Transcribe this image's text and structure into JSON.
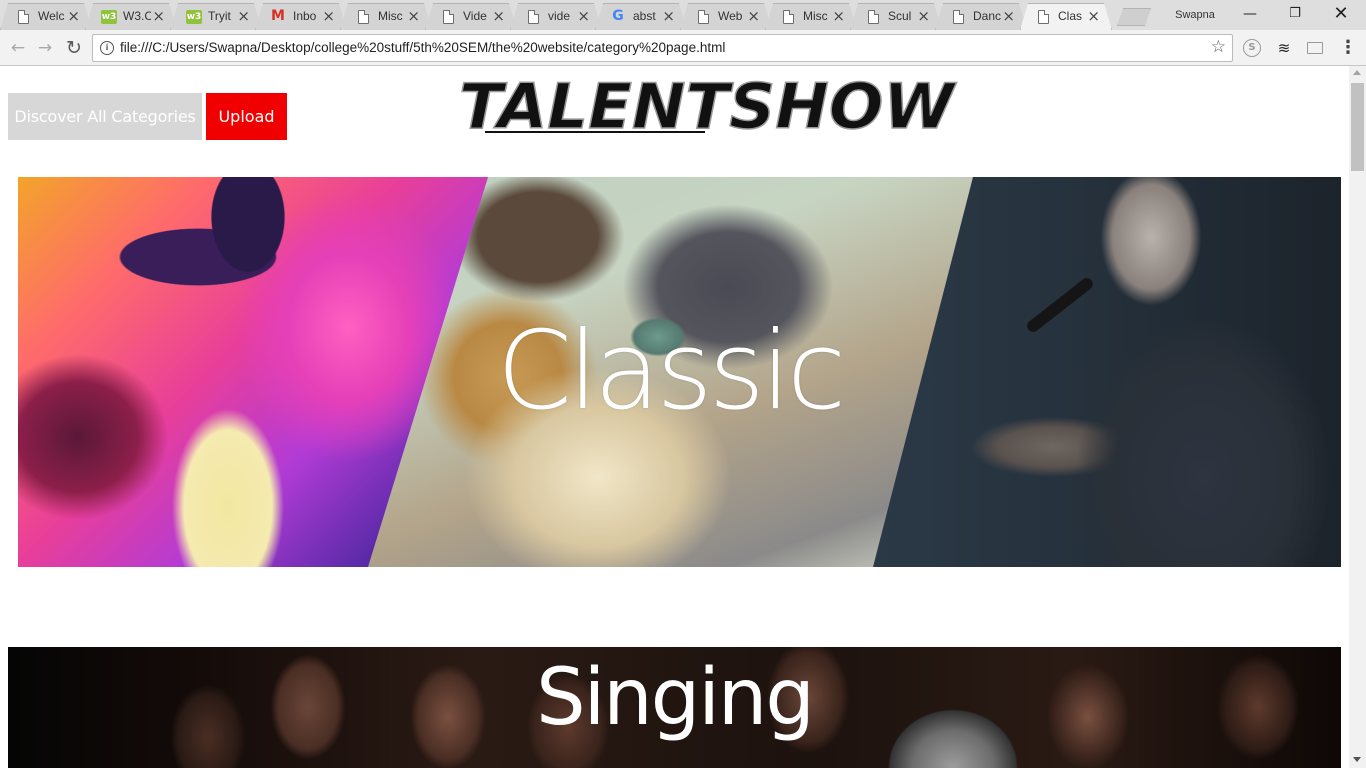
{
  "browser": {
    "tabs": [
      {
        "title": "Welc",
        "favicon": "page-icon",
        "active": false
      },
      {
        "title": "W3.C",
        "favicon": "w3-icon",
        "active": false
      },
      {
        "title": "Tryit",
        "favicon": "w3-icon",
        "active": false
      },
      {
        "title": "Inbo",
        "favicon": "gmail-icon",
        "active": false
      },
      {
        "title": "Misc",
        "favicon": "page-icon",
        "active": false
      },
      {
        "title": "Vide",
        "favicon": "page-icon",
        "active": false
      },
      {
        "title": "vide",
        "favicon": "page-icon",
        "active": false
      },
      {
        "title": "abst",
        "favicon": "google-icon",
        "active": false
      },
      {
        "title": "Web",
        "favicon": "page-icon",
        "active": false
      },
      {
        "title": "Misc",
        "favicon": "page-icon",
        "active": false
      },
      {
        "title": "Scul",
        "favicon": "page-icon",
        "active": false
      },
      {
        "title": "Danc",
        "favicon": "page-icon",
        "active": false
      },
      {
        "title": "Clas",
        "favicon": "page-icon",
        "active": true
      }
    ],
    "profile_name": "Swapna",
    "url": "file:///C:/Users/Swapna/Desktop/college%20stuff/5th%20SEM/the%20website/category%20page.html",
    "w3_glyph": "w3",
    "gmail_glyph": "M",
    "google_glyph": "G"
  },
  "page": {
    "discover_label": "Discover All Categories",
    "upload_label": "Upload",
    "logo_text": "TALENTSHOW",
    "sections": {
      "classic_title": "Classic",
      "singing_title": "Singing"
    }
  },
  "colors": {
    "upload_bg": "#f00000",
    "discover_bg": "#d7d7d7"
  }
}
